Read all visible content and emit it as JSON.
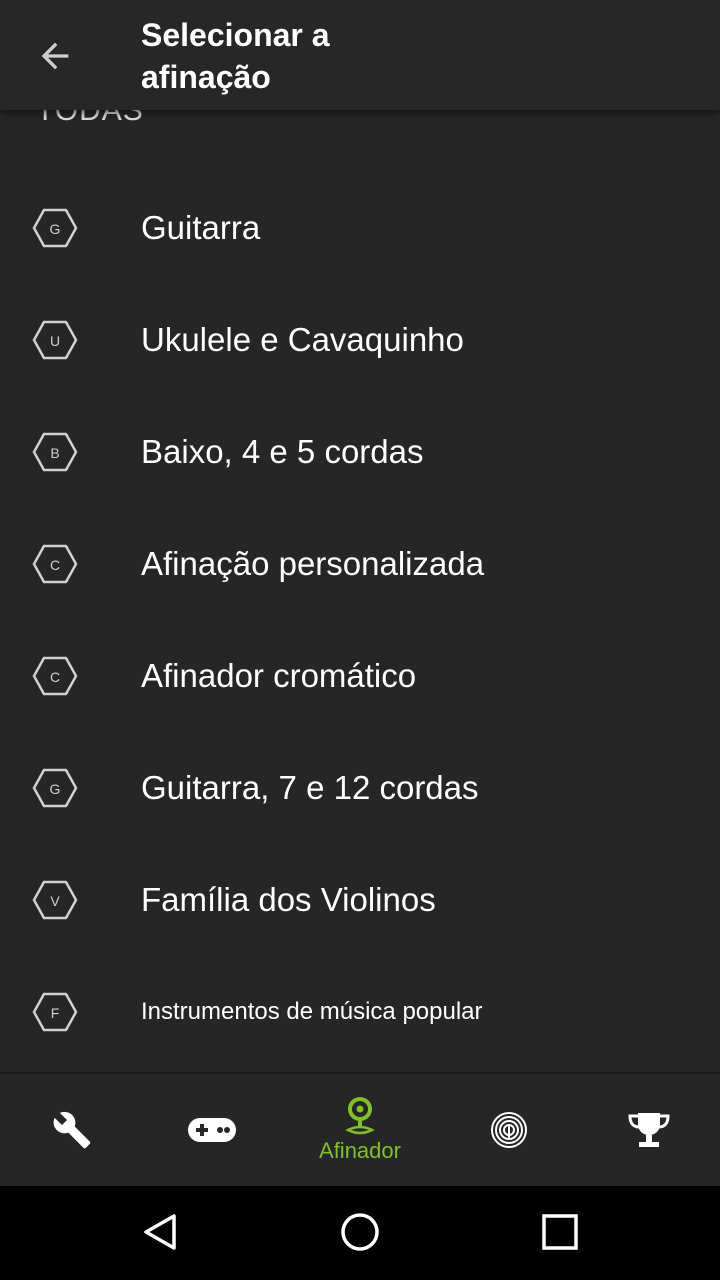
{
  "appbar": {
    "title": "Selecionar a afinação",
    "back_icon": "arrow-left-icon"
  },
  "list": {
    "section_header": "TODAS",
    "items": [
      {
        "badge": "G",
        "label": "Guitarra"
      },
      {
        "badge": "U",
        "label": "Ukulele e Cavaquinho"
      },
      {
        "badge": "B",
        "label": "Baixo, 4 e 5 cordas"
      },
      {
        "badge": "C",
        "label": "Afinação personalizada"
      },
      {
        "badge": "C",
        "label": "Afinador cromático"
      },
      {
        "badge": "G",
        "label": "Guitarra, 7 e 12 cordas"
      },
      {
        "badge": "V",
        "label": "Família dos Violinos"
      },
      {
        "badge": "F",
        "label": "Instrumentos de música popular"
      }
    ]
  },
  "bottom_nav": {
    "active_label": "Afinador",
    "items": [
      {
        "icon": "wrench-icon"
      },
      {
        "icon": "gamepad-icon"
      },
      {
        "icon": "tuner-pin-icon",
        "label": "Afinador",
        "active": true
      },
      {
        "icon": "fingerprint-icon"
      },
      {
        "icon": "trophy-icon"
      }
    ]
  },
  "colors": {
    "background": "#262626",
    "accent": "#7ec21f",
    "text": "#ffffff",
    "system_bar": "#000000"
  },
  "system_nav": {
    "icons": [
      "back-triangle-icon",
      "home-circle-icon",
      "recents-square-icon"
    ]
  }
}
